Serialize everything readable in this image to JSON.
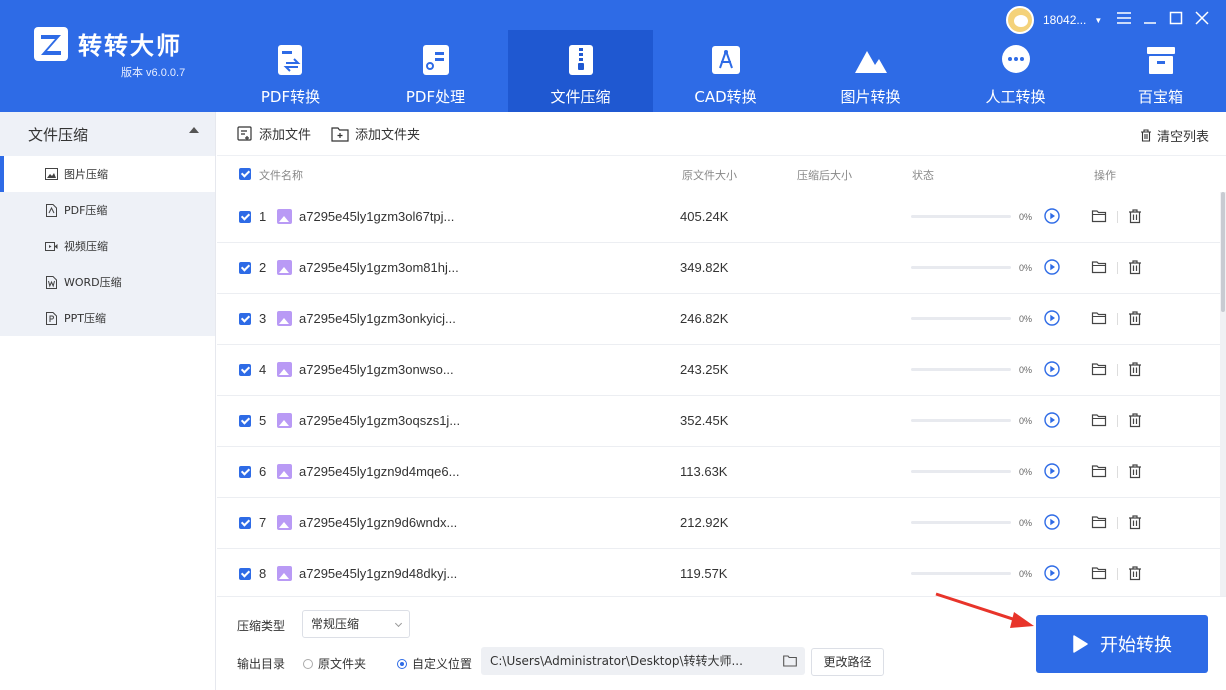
{
  "app": {
    "name": "转转大师",
    "version": "版本 v6.0.0.7"
  },
  "user": {
    "name": "18042..."
  },
  "nav": [
    {
      "label": "PDF转换",
      "icon": "pdf-convert-icon"
    },
    {
      "label": "PDF处理",
      "icon": "pdf-process-icon"
    },
    {
      "label": "文件压缩",
      "icon": "file-compress-icon",
      "active": true
    },
    {
      "label": "CAD转换",
      "icon": "cad-icon"
    },
    {
      "label": "图片转换",
      "icon": "image-convert-icon"
    },
    {
      "label": "人工转换",
      "icon": "chat-icon"
    },
    {
      "label": "百宝箱",
      "icon": "toolbox-icon"
    }
  ],
  "sidebar": {
    "header": "文件压缩",
    "items": [
      {
        "label": "图片压缩",
        "icon": "image-icon",
        "active": true
      },
      {
        "label": "PDF压缩",
        "icon": "pdf-icon"
      },
      {
        "label": "视频压缩",
        "icon": "video-icon"
      },
      {
        "label": "WORD压缩",
        "icon": "word-icon"
      },
      {
        "label": "PPT压缩",
        "icon": "ppt-icon"
      }
    ]
  },
  "toolbar": {
    "add_file": "添加文件",
    "add_folder": "添加文件夹",
    "clear": "清空列表"
  },
  "table": {
    "headers": {
      "name": "文件名称",
      "orig_size": "原文件大小",
      "comp_size": "压缩后大小",
      "status": "状态",
      "action": "操作"
    },
    "rows": [
      {
        "idx": "1",
        "name": "a7295e45ly1gzm3ol67tpj...",
        "size": "405.24K",
        "progress": "0%"
      },
      {
        "idx": "2",
        "name": "a7295e45ly1gzm3om81hj...",
        "size": "349.82K",
        "progress": "0%"
      },
      {
        "idx": "3",
        "name": "a7295e45ly1gzm3onkyicj...",
        "size": "246.82K",
        "progress": "0%"
      },
      {
        "idx": "4",
        "name": "a7295e45ly1gzm3onwso...",
        "size": "243.25K",
        "progress": "0%"
      },
      {
        "idx": "5",
        "name": "a7295e45ly1gzm3oqszs1j...",
        "size": "352.45K",
        "progress": "0%"
      },
      {
        "idx": "6",
        "name": "a7295e45ly1gzn9d4mqe6...",
        "size": "113.63K",
        "progress": "0%"
      },
      {
        "idx": "7",
        "name": "a7295e45ly1gzn9d6wndx...",
        "size": "212.92K",
        "progress": "0%"
      },
      {
        "idx": "8",
        "name": "a7295e45ly1gzn9d48dkyj...",
        "size": "119.57K",
        "progress": "0%"
      }
    ]
  },
  "bottom": {
    "type_label": "压缩类型",
    "type_value": "常规压缩",
    "output_label": "输出目录",
    "radio_original": "原文件夹",
    "radio_custom": "自定义位置",
    "path": "C:\\Users\\Administrator\\Desktop\\转转大师...",
    "change_path": "更改路径",
    "start": "开始转换"
  },
  "colors": {
    "primary": "#2e6be6",
    "nav_active": "#1f58d1",
    "annotation_arrow": "#e8342a"
  }
}
